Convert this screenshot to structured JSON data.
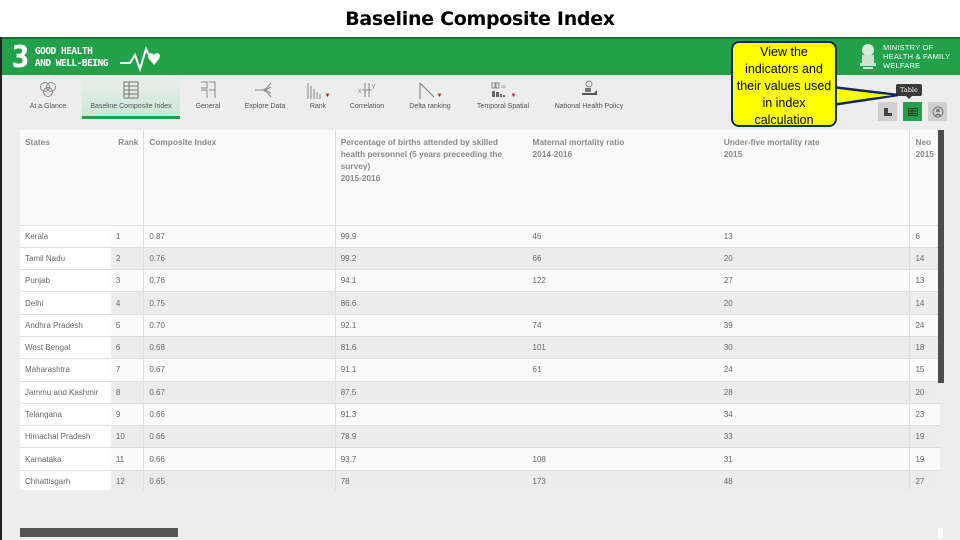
{
  "slide": {
    "title": "Baseline Composite Index"
  },
  "header": {
    "sdg_number": "3",
    "sdg_line1": "GOOD HEALTH",
    "sdg_line2": "AND WELL-BEING",
    "ministry_line1": "MINISTRY OF",
    "ministry_line2": "HEALTH & FAMILY",
    "ministry_line3": "WELFARE",
    "brand_color": "#23a04a"
  },
  "nav": {
    "items": [
      {
        "label": "At a Glance",
        "icon": "circles-icon",
        "active": false
      },
      {
        "label": "Baseline Composite Index",
        "icon": "table-grid-icon",
        "active": true
      },
      {
        "label": "General",
        "icon": "layout-icon",
        "active": false
      },
      {
        "label": "Explore Data",
        "icon": "tree-branch-icon",
        "active": false
      },
      {
        "label": "Rank",
        "icon": "bar-rank-icon",
        "active": false,
        "dropdown": true
      },
      {
        "label": "Correlation",
        "icon": "xy-correlation-icon",
        "active": false
      },
      {
        "label": "Delta ranking",
        "icon": "delta-line-icon",
        "active": false,
        "dropdown": true
      },
      {
        "label": "Temporal Spatial",
        "icon": "temporal-icon",
        "active": false,
        "dropdown": true
      },
      {
        "label": "National Health Policy",
        "icon": "hand-policy-icon",
        "active": false
      }
    ]
  },
  "view_toggle": {
    "tooltip": "Table",
    "buttons": [
      {
        "name": "chart-view",
        "icon": "chart-view-icon",
        "active": false
      },
      {
        "name": "table-view",
        "icon": "table-view-icon",
        "active": true
      },
      {
        "name": "profile-view",
        "icon": "person-icon",
        "active": false
      }
    ]
  },
  "callout": {
    "text": "View the indicators and their values used in index calculation"
  },
  "table": {
    "columns": [
      {
        "label": "States",
        "sub": ""
      },
      {
        "label": "Rank",
        "sub": ""
      },
      {
        "label": "Composite Index",
        "sub": ""
      },
      {
        "label": "Percentage of births attended by skilled health personnel (5 years preceeding the survey)",
        "sub": "2015-2016"
      },
      {
        "label": "Maternal mortality ratio",
        "sub": "2014-2016"
      },
      {
        "label": "Under-five mortality rate",
        "sub": "2015"
      },
      {
        "label": "Neo",
        "sub": "2015"
      }
    ],
    "rows": [
      [
        "Kerala",
        "1",
        "0.87",
        "99.9",
        "46",
        "13",
        "6"
      ],
      [
        "Tamil Nadu",
        "2",
        "0.76",
        "99.2",
        "66",
        "20",
        "14"
      ],
      [
        "Punjab",
        "3",
        "0.76",
        "94.1",
        "122",
        "27",
        "13"
      ],
      [
        "Delhi",
        "4",
        "0.75",
        "86.6",
        "",
        "20",
        "14"
      ],
      [
        "Andhra Pradesh",
        "5",
        "0.70",
        "92.1",
        "74",
        "39",
        "24"
      ],
      [
        "West Bengal",
        "6",
        "0.68",
        "81.6",
        "101",
        "30",
        "18"
      ],
      [
        "Maharashtra",
        "7",
        "0.67",
        "91.1",
        "61",
        "24",
        "15"
      ],
      [
        "Jammu and Kashmir",
        "8",
        "0.67",
        "87.5",
        "",
        "28",
        "20"
      ],
      [
        "Telangana",
        "9",
        "0.66",
        "91.3",
        "",
        "34",
        "23"
      ],
      [
        "Himachal Pradesh",
        "10",
        "0.66",
        "78.9",
        "",
        "33",
        "19"
      ],
      [
        "Karnataka",
        "11",
        "0.66",
        "93.7",
        "108",
        "31",
        "19"
      ],
      [
        "Chhattisgarh",
        "12",
        "0.65",
        "78",
        "173",
        "48",
        "27"
      ]
    ]
  }
}
